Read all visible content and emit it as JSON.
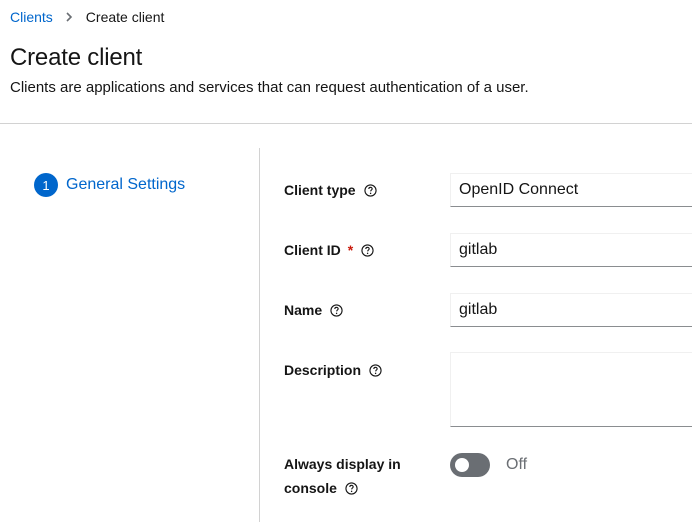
{
  "breadcrumb": {
    "parent": "Clients",
    "current": "Create client"
  },
  "header": {
    "title": "Create client",
    "subtitle": "Clients are applications and services that can request authentication of a user."
  },
  "wizard": {
    "steps": [
      {
        "number": "1",
        "label": "General Settings"
      }
    ]
  },
  "form": {
    "client_type": {
      "label": "Client type",
      "value": "OpenID Connect"
    },
    "client_id": {
      "label": "Client ID",
      "required_mark": "*",
      "value": "gitlab"
    },
    "name": {
      "label": "Name",
      "value": "gitlab"
    },
    "description": {
      "label": "Description",
      "value": ""
    },
    "always_display": {
      "label_line1": "Always display in",
      "label_line2": "console",
      "state_text": "Off",
      "enabled": false
    }
  },
  "colors": {
    "accent": "#0066cc",
    "required": "#c9190b",
    "toggle_off": "#6a6e73"
  }
}
